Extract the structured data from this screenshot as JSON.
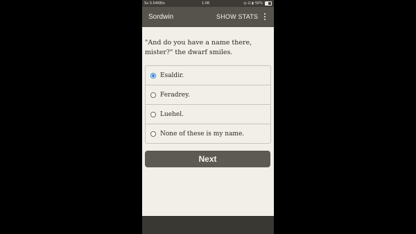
{
  "status_bar": {
    "left_text": "Sx 0.54KB/s",
    "time": "1:06",
    "battery_text": "50%",
    "signal_icons": "◎ ⊡ ▮"
  },
  "app_bar": {
    "title": "Sordwin",
    "show_stats_label": "SHOW STATS"
  },
  "prompt": "\"And do you have a name there, mister?\" the dwarf smiles.",
  "options": [
    {
      "label": "Esaldir.",
      "selected": true
    },
    {
      "label": "Feradrey.",
      "selected": false
    },
    {
      "label": "Luehel.",
      "selected": false
    },
    {
      "label": "None of these is my name.",
      "selected": false
    }
  ],
  "next_label": "Next",
  "colors": {
    "accent": "#2d7fd3",
    "app_bar": "#56534c",
    "background": "#f1efe8",
    "button": "#5d5a53"
  }
}
